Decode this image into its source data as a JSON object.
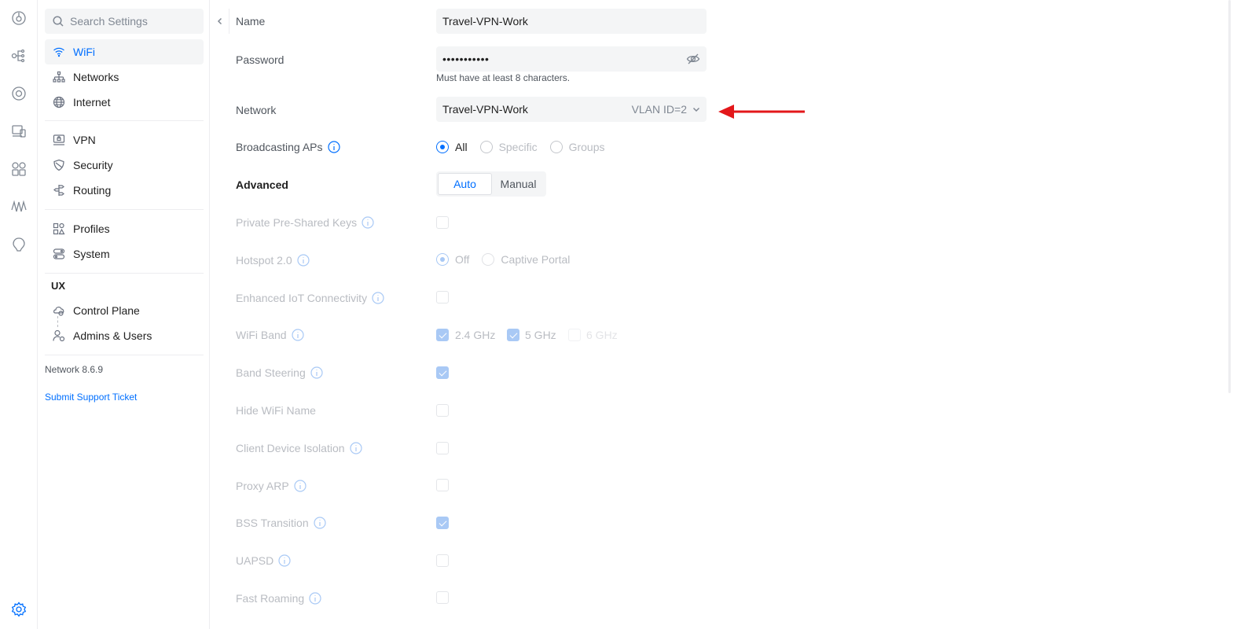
{
  "rail": {
    "icons": [
      "dashboard-icon",
      "topology-icon",
      "devices-icon",
      "clients-icon",
      "apps-icon",
      "insights-icon",
      "innerspace-icon",
      "settings-icon"
    ]
  },
  "sidebar": {
    "search_placeholder": "Search Settings",
    "groups": [
      [
        {
          "label": "WiFi",
          "icon": "wifi-icon",
          "active": true
        },
        {
          "label": "Networks",
          "icon": "networks-icon"
        },
        {
          "label": "Internet",
          "icon": "globe-icon"
        }
      ],
      [
        {
          "label": "VPN",
          "icon": "vpn-icon"
        },
        {
          "label": "Security",
          "icon": "shield-icon"
        },
        {
          "label": "Routing",
          "icon": "routing-icon"
        }
      ],
      [
        {
          "label": "Profiles",
          "icon": "profiles-icon"
        },
        {
          "label": "System",
          "icon": "system-icon"
        }
      ]
    ],
    "ux_title": "UX",
    "ux_items": [
      {
        "label": "Control Plane",
        "icon": "control-plane-icon"
      },
      {
        "label": "Admins & Users",
        "icon": "admins-icon"
      }
    ],
    "version": "Network 8.6.9",
    "support_link": "Submit Support Ticket"
  },
  "form": {
    "name_label": "Name",
    "name_value": "Travel-VPN-Work",
    "password_label": "Password",
    "password_value": "•••••••••••",
    "password_hint": "Must have at least 8 characters.",
    "network_label": "Network",
    "network_value": "Travel-VPN-Work",
    "network_vlan": "VLAN ID=2",
    "broadcasting_label": "Broadcasting APs",
    "broadcasting_options": [
      "All",
      "Specific",
      "Groups"
    ],
    "broadcasting_selected": "All",
    "advanced_label": "Advanced",
    "advanced_options": [
      "Auto",
      "Manual"
    ],
    "advanced_selected": "Auto",
    "private_psk_label": "Private Pre-Shared Keys",
    "hotspot_label": "Hotspot 2.0",
    "hotspot_options": [
      "Off",
      "Captive Portal"
    ],
    "hotspot_selected": "Off",
    "iot_label": "Enhanced IoT Connectivity",
    "wifi_band_label": "WiFi Band",
    "wifi_band_options": [
      {
        "label": "2.4 GHz",
        "checked": true
      },
      {
        "label": "5 GHz",
        "checked": true
      },
      {
        "label": "6 GHz",
        "checked": false
      }
    ],
    "band_steering_label": "Band Steering",
    "band_steering_checked": true,
    "hide_name_label": "Hide WiFi Name",
    "hide_name_checked": false,
    "client_isolation_label": "Client Device Isolation",
    "client_isolation_checked": false,
    "proxy_arp_label": "Proxy ARP",
    "proxy_arp_checked": false,
    "bss_label": "BSS Transition",
    "bss_checked": true,
    "uapsd_label": "UAPSD",
    "uapsd_checked": false,
    "fast_roaming_label": "Fast Roaming",
    "fast_roaming_checked": false
  },
  "colors": {
    "accent": "#006fff",
    "annotation_arrow": "#e3171a",
    "disabled_text": "#b9bcc2"
  }
}
